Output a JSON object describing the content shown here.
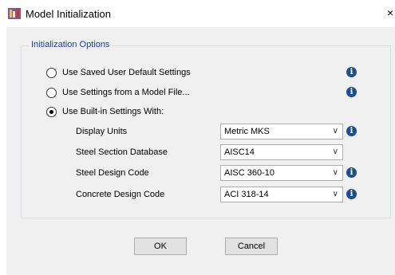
{
  "window": {
    "title": "Model Initialization",
    "close_glyph": "×"
  },
  "group": {
    "label": "Initialization Options"
  },
  "options": [
    {
      "label": "Use Saved User Default Settings",
      "checked": false
    },
    {
      "label": "Use Settings from a Model File...",
      "checked": false
    },
    {
      "label": "Use Built-in Settings With:",
      "checked": true
    }
  ],
  "settings": {
    "display_units": {
      "label": "Display Units",
      "value": "Metric MKS"
    },
    "steel_section_db": {
      "label": "Steel Section Database",
      "value": "AISC14"
    },
    "steel_design_code": {
      "label": "Steel Design Code",
      "value": "AISC 360-10"
    },
    "concrete_design_code": {
      "label": "Concrete Design Code",
      "value": "ACI 318-14"
    }
  },
  "icons": {
    "info_glyph": "i",
    "chevron_glyph": "∨"
  },
  "buttons": {
    "ok": "OK",
    "cancel": "Cancel"
  },
  "colors": {
    "group_label": "#1a3fa8",
    "info_icon": "#1d4f8f"
  }
}
